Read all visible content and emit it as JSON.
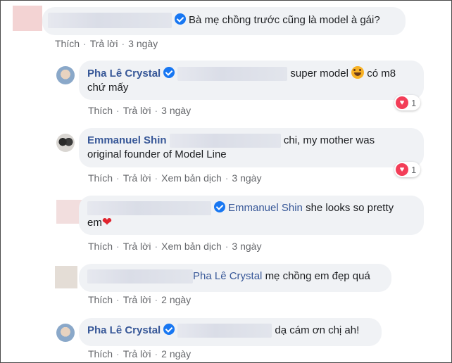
{
  "colors": {
    "link": "#385898",
    "bubble": "#f0f2f5",
    "meta": "#65676b",
    "verified": "#1877f2",
    "heart": "#f33e58"
  },
  "actions": {
    "like": "Thích",
    "reply": "Trả lời",
    "translate": "Xem bản dịch",
    "separator": "·"
  },
  "comments": [
    {
      "text": "Bà mẹ chồng trước cũng là model à gái?",
      "time": "3 ngày"
    },
    {
      "author": "Pha Lê Crystal",
      "text_before": "super model",
      "emoji": "rolling-laughing-emoji",
      "text_after": "có m8",
      "line2": "chứ mấy",
      "time": "3 ngày",
      "reactions": "1"
    },
    {
      "author": "Emmanuel Shin",
      "text": "chi, my mother was",
      "line2": "original founder of Model Line",
      "time": "3 ngày",
      "reactions": "1"
    },
    {
      "mention": "Emmanuel Shin",
      "text": "she looks so pretty",
      "line2": "em",
      "emoji": "red-heart-icon",
      "time": "3 ngày"
    },
    {
      "mention": "Pha Lê Crystal",
      "text": "mẹ chồng em đẹp quá",
      "time": "2 ngày"
    },
    {
      "author": "Pha Lê Crystal",
      "text": "dạ cám ơn chị ah!",
      "time": "2 ngày"
    }
  ]
}
